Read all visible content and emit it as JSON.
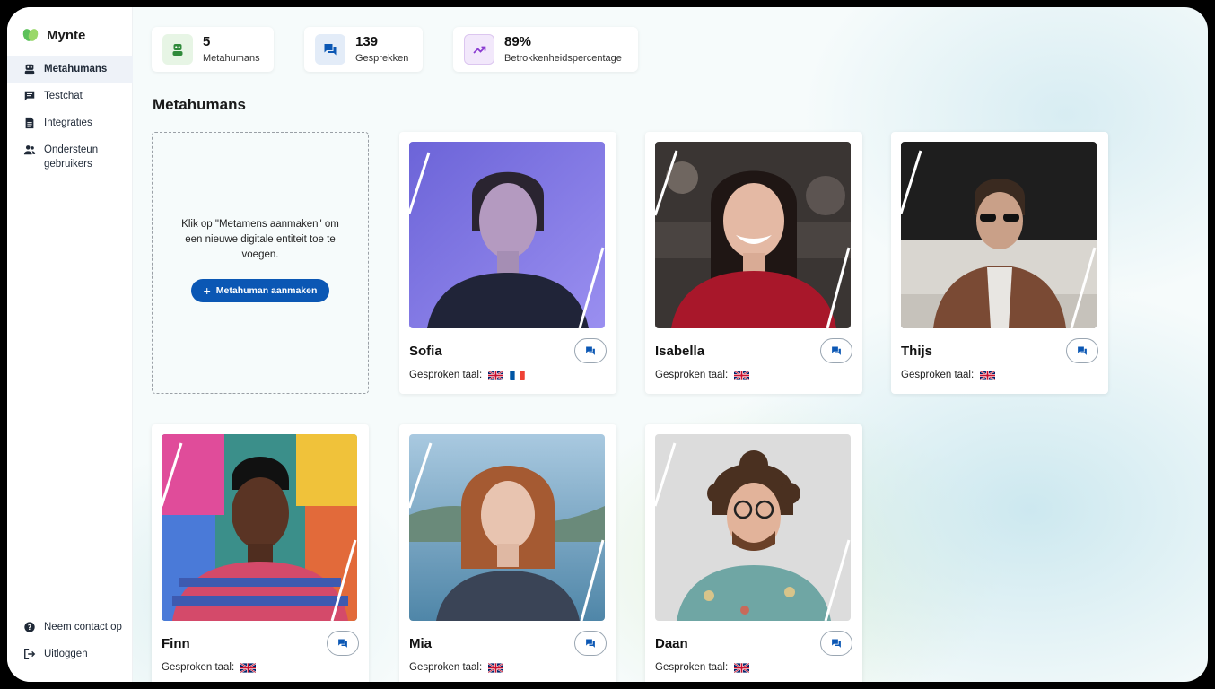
{
  "app": {
    "name": "Mynte"
  },
  "nav": {
    "items": [
      {
        "label": "Metahumans",
        "icon": "robot-icon",
        "active": true
      },
      {
        "label": "Testchat",
        "icon": "chat-icon",
        "active": false
      },
      {
        "label": "Integraties",
        "icon": "document-icon",
        "active": false
      },
      {
        "label": "Ondersteun gebruikers",
        "icon": "users-icon",
        "active": false
      }
    ],
    "bottom": [
      {
        "label": "Neem contact op",
        "icon": "help-icon"
      },
      {
        "label": "Uitloggen",
        "icon": "logout-icon"
      }
    ]
  },
  "stats": [
    {
      "value": "5",
      "label": "Metahumans",
      "icon": "robot-icon",
      "color": "#2f8a3a",
      "bg": "#e7f5e5"
    },
    {
      "value": "139",
      "label": "Gesprekken",
      "icon": "chat-icon",
      "color": "#0b57b4",
      "bg": "#e3ecf8"
    },
    {
      "value": "89%",
      "label": "Betrokkenheidspercentage",
      "icon": "trending-up-icon",
      "color": "#8a3bd1",
      "bg": "#f2e8fb"
    }
  ],
  "section_title": "Metahumans",
  "create": {
    "text": "Klik op \"Metamens aanmaken\" om een nieuwe digitale entiteit toe te voegen.",
    "button": "Metahuman aanmaken"
  },
  "language_label": "Gesproken taal:",
  "metahumans": [
    {
      "name": "Sofia",
      "flags": [
        "uk-flag-icon",
        "fr-flag-icon"
      ]
    },
    {
      "name": "Isabella",
      "flags": [
        "uk-flag-icon"
      ]
    },
    {
      "name": "Thijs",
      "flags": [
        "uk-flag-icon"
      ]
    },
    {
      "name": "Finn",
      "flags": [
        "uk-flag-icon"
      ]
    },
    {
      "name": "Mia",
      "flags": [
        "uk-flag-icon"
      ]
    },
    {
      "name": "Daan",
      "flags": [
        "uk-flag-icon"
      ]
    }
  ]
}
